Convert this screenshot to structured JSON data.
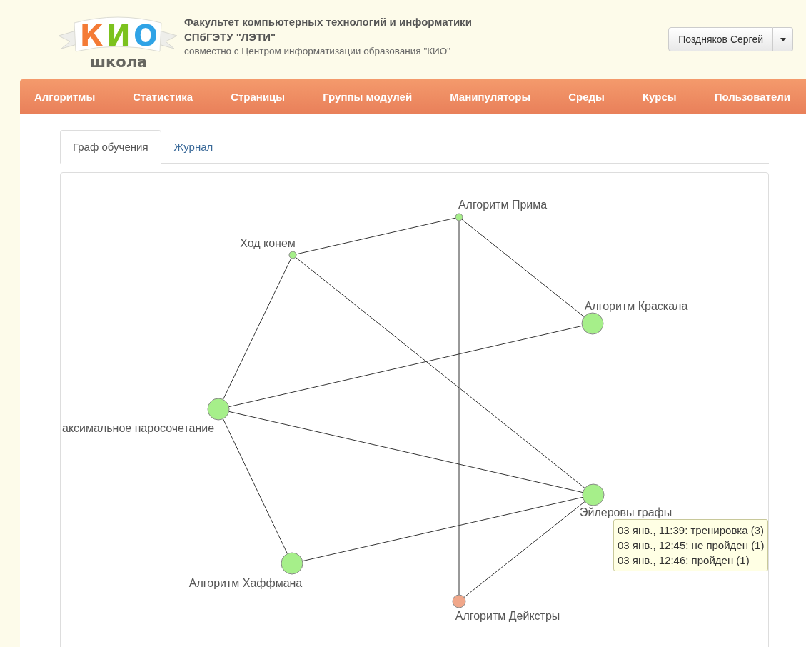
{
  "header": {
    "logo": {
      "letters": [
        {
          "text": "К",
          "color": "#f47b36"
        },
        {
          "text": "И",
          "color": "#7cc21e"
        },
        {
          "text": "О",
          "color": "#2fa3e6"
        }
      ],
      "caption": "школа"
    },
    "title_lines": [
      "Факультет компьютерных технологий и информатики",
      "СПбГЭТУ \"ЛЭТИ\""
    ],
    "subtitle": "совместно с Центром информатизации образования \"КИО\"",
    "user_button": {
      "label": "Поздняков Сергей"
    }
  },
  "nav": [
    {
      "label": "Алгоритмы"
    },
    {
      "label": "Статистика"
    },
    {
      "label": "Страницы"
    },
    {
      "label": "Группы модулей"
    },
    {
      "label": "Манипуляторы"
    },
    {
      "label": "Среды"
    },
    {
      "label": "Курсы"
    },
    {
      "label": "Пользователи"
    }
  ],
  "tabs": [
    {
      "label": "Граф обучения",
      "selected": true
    },
    {
      "label": "Журнал",
      "selected": false
    }
  ],
  "graph": {
    "nodes": [
      {
        "label": "Алгоритм Прима",
        "kind": "small",
        "color": "#a6ef8a"
      },
      {
        "label": "Ход конем",
        "kind": "small",
        "color": "#a6ef8a"
      },
      {
        "label": "Алгоритм Краскала",
        "kind": "large",
        "color": "#a6ef8a"
      },
      {
        "label": "аксимальное паросочетание",
        "kind": "large",
        "color": "#a6ef8a"
      },
      {
        "label": "Эйлеровы графы",
        "kind": "large",
        "color": "#a6ef8a",
        "tooltip": [
          "03 янв., 11:39: тренировка (3)",
          "03 янв., 12:45: не пройден (1)",
          "03 янв., 12:46: пройден (1)"
        ]
      },
      {
        "label": "Алгоритм Хаффмана",
        "kind": "large",
        "color": "#a6ef8a"
      },
      {
        "label": "Алгоритм Дейкстры",
        "kind": "medium",
        "color": "#f0a78a"
      }
    ]
  }
}
